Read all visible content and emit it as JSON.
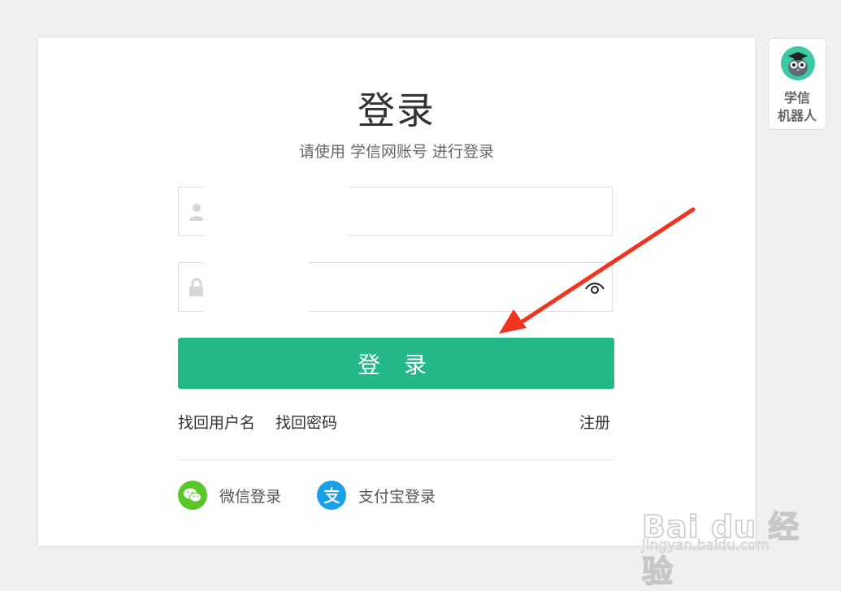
{
  "login": {
    "title": "登录",
    "subtitle": "请使用 学信网账号 进行登录",
    "username": {
      "value": "",
      "placeholder": ""
    },
    "password": {
      "value": "",
      "placeholder": ""
    },
    "submit_label": "登 录"
  },
  "links": {
    "recover_username": "找回用户名",
    "recover_password": "找回密码",
    "register": "注册"
  },
  "social": {
    "wechat_label": "微信登录",
    "alipay_label": "支付宝登录"
  },
  "robot": {
    "line1": "学信",
    "line2": "机器人"
  },
  "watermark": {
    "brand": "Bai du 经验",
    "url": "jingyan.baidu.com"
  },
  "colors": {
    "primary": "#24b787",
    "wechat": "#5ac729",
    "alipay": "#1aa0e6",
    "arrow": "#f2331f"
  },
  "icons": [
    "user-icon",
    "lock-icon",
    "eye-icon",
    "wechat-icon",
    "alipay-icon",
    "robot-avatar-icon"
  ]
}
